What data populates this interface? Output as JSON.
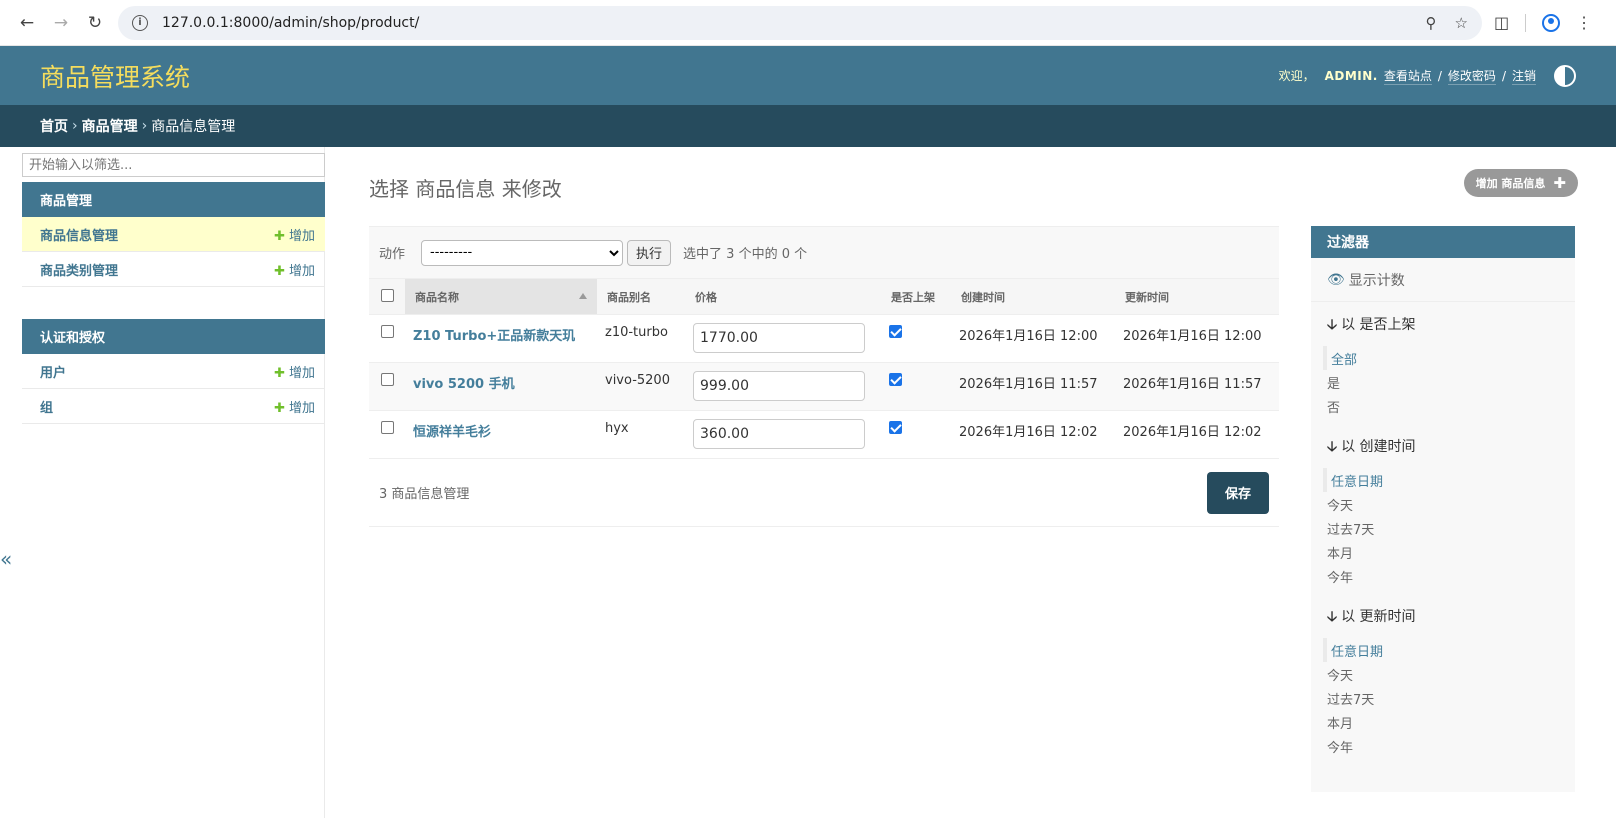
{
  "browser": {
    "url": "127.0.0.1:8000/admin/shop/product/"
  },
  "header": {
    "branding": "商品管理系统",
    "welcome": "欢迎，",
    "username": "ADMIN.",
    "view_site": "查看站点",
    "change_password": "修改密码",
    "logout": "注销",
    "slash": "/"
  },
  "breadcrumbs": {
    "home": "首页",
    "app": "商品管理",
    "current": "商品信息管理",
    "sep": "›"
  },
  "sidebar": {
    "filter_placeholder": "开始输入以筛选...",
    "toggle": "«",
    "modules": [
      {
        "caption": "商品管理",
        "items": [
          {
            "label": "商品信息管理",
            "add": "增加"
          },
          {
            "label": "商品类别管理",
            "add": "增加"
          }
        ]
      },
      {
        "caption": "认证和授权",
        "items": [
          {
            "label": "用户",
            "add": "增加"
          },
          {
            "label": "组",
            "add": "增加"
          }
        ]
      }
    ]
  },
  "content": {
    "title": "选择 商品信息 来修改",
    "add_button": "增加 商品信息",
    "actions": {
      "label": "动作",
      "selected": "---------",
      "go": "执行",
      "counter": "选中了 3 个中的 0 个"
    },
    "columns": [
      "商品名称",
      "商品别名",
      "价格",
      "是否上架",
      "创建时间",
      "更新时间"
    ],
    "rows": [
      {
        "name": "Z10 Turbo+正品新款天玑",
        "alias": "z10-turbo",
        "price": "1770.00",
        "on_sale": true,
        "created": "2026年1月16日 12:00",
        "updated": "2026年1月16日 12:00"
      },
      {
        "name": "vivo 5200 手机",
        "alias": "vivo-5200",
        "price": "999.00",
        "on_sale": true,
        "created": "2026年1月16日 11:57",
        "updated": "2026年1月16日 11:57"
      },
      {
        "name": "恒源祥羊毛衫",
        "alias": "hyx",
        "price": "360.00",
        "on_sale": true,
        "created": "2026年1月16日 12:02",
        "updated": "2026年1月16日 12:02"
      }
    ],
    "paginator": "3 商品信息管理",
    "save": "保存"
  },
  "filter": {
    "title": "过滤器",
    "show_counts": "显示计数",
    "sections": [
      {
        "title": "以 是否上架",
        "options": [
          "全部",
          "是",
          "否"
        ]
      },
      {
        "title": "以 创建时间",
        "options": [
          "任意日期",
          "今天",
          "过去7天",
          "本月",
          "今年"
        ]
      },
      {
        "title": "以 更新时间",
        "options": [
          "任意日期",
          "今天",
          "过去7天",
          "本月",
          "今年"
        ]
      }
    ]
  },
  "colors": {
    "header_bg": "#417690",
    "breadcrumb_bg": "#264b5d",
    "branding": "#f5dd5d",
    "link": "#447e9b",
    "add_green": "#70bf2b"
  }
}
